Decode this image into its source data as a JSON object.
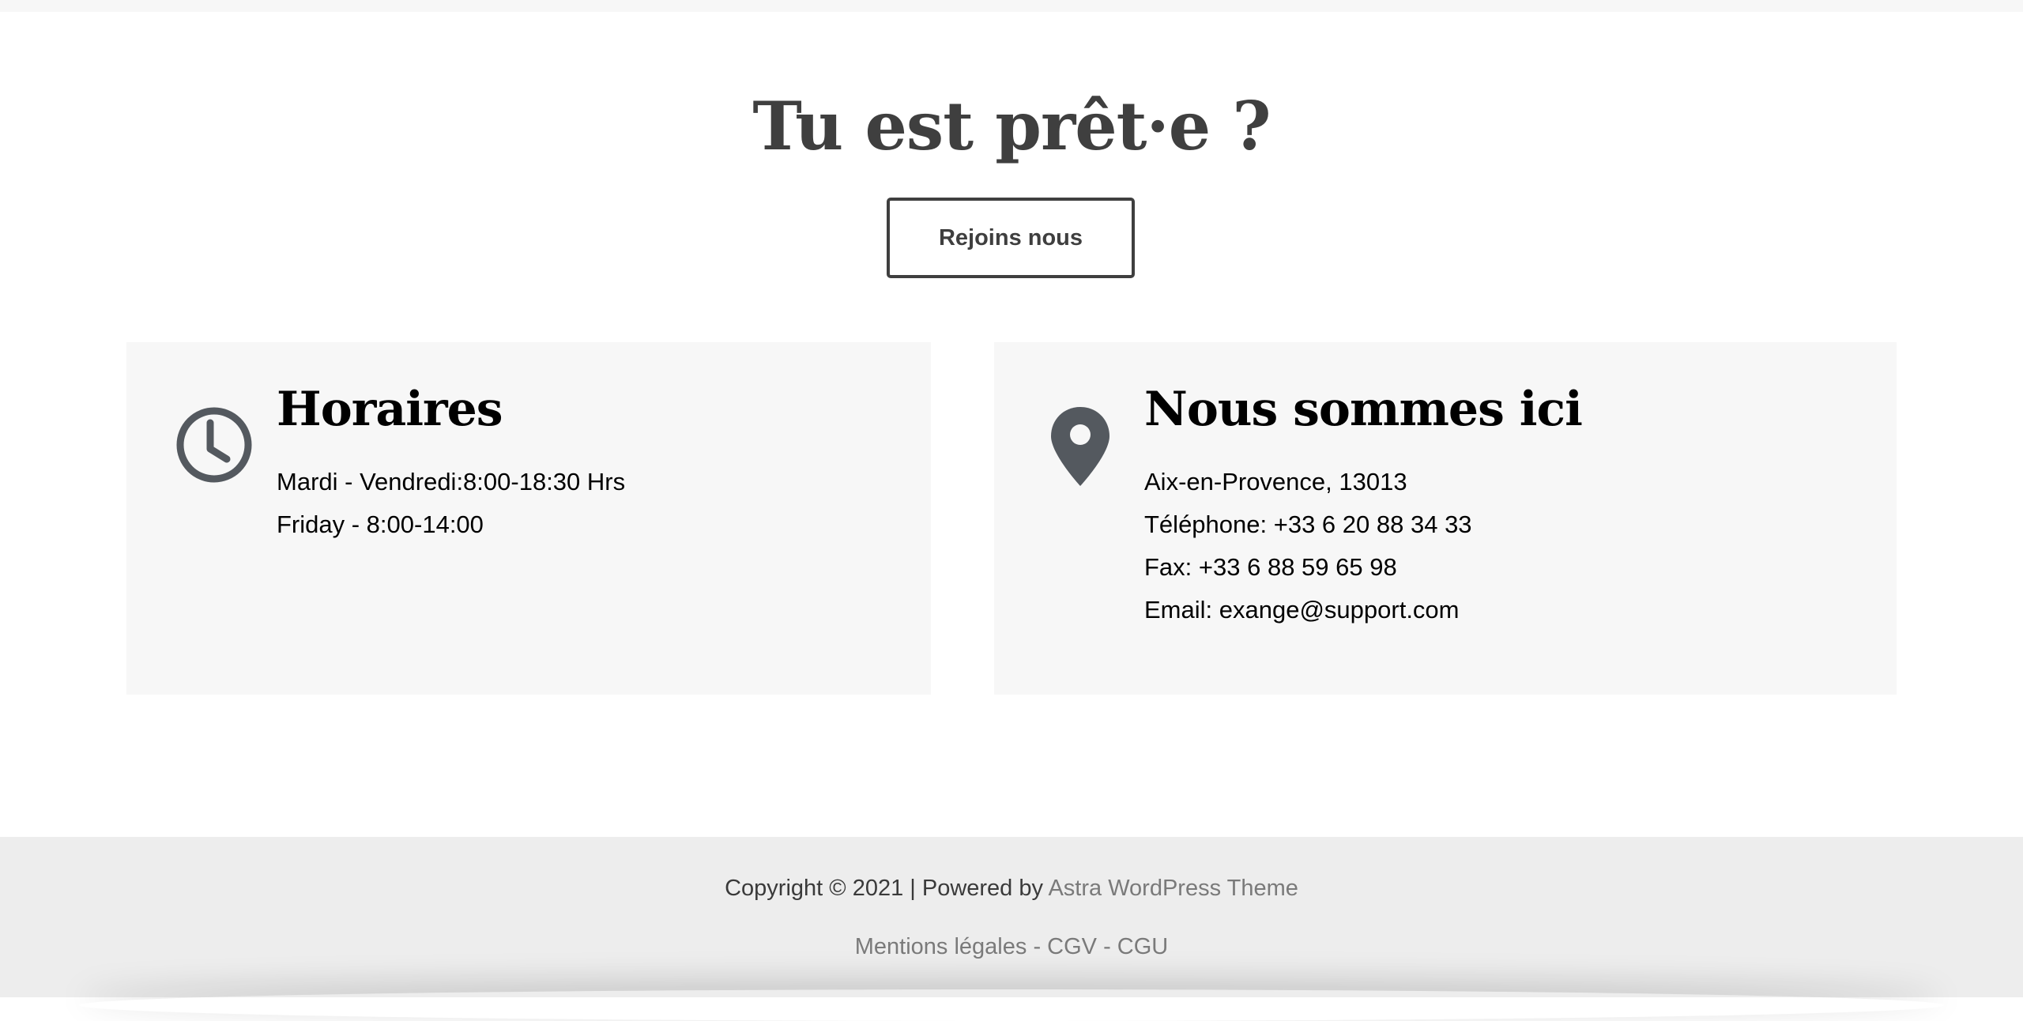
{
  "cta": {
    "title": "Tu est prêt·e ?",
    "button_label": "Rejoins nous"
  },
  "hours_card": {
    "icon": "clock-icon",
    "title": "Horaires",
    "lines": [
      "Mardi - Vendredi:8:00-18:30 Hrs",
      "Friday - 8:00-14:00"
    ]
  },
  "location_card": {
    "icon": "map-pin-icon",
    "title": "Nous sommes ici",
    "lines": [
      "Aix-en-Provence, 13013",
      "Téléphone: +33 6 20 88 34 33",
      "Fax: +33 6 88 59 65 98",
      "Email: exange@support.com"
    ]
  },
  "footer": {
    "copyright_text": "Copyright © 2021 | Powered by ",
    "theme_link": "Astra WordPress Theme",
    "legal_links": [
      "Mentions légales",
      "CGV",
      "CGU"
    ],
    "separator": " - "
  },
  "colors": {
    "heading": "#3f3f3f",
    "card_bg": "#f7f7f7",
    "footer_bg": "#ededed",
    "icon": "#54595f",
    "link": "#7a7a7a"
  }
}
